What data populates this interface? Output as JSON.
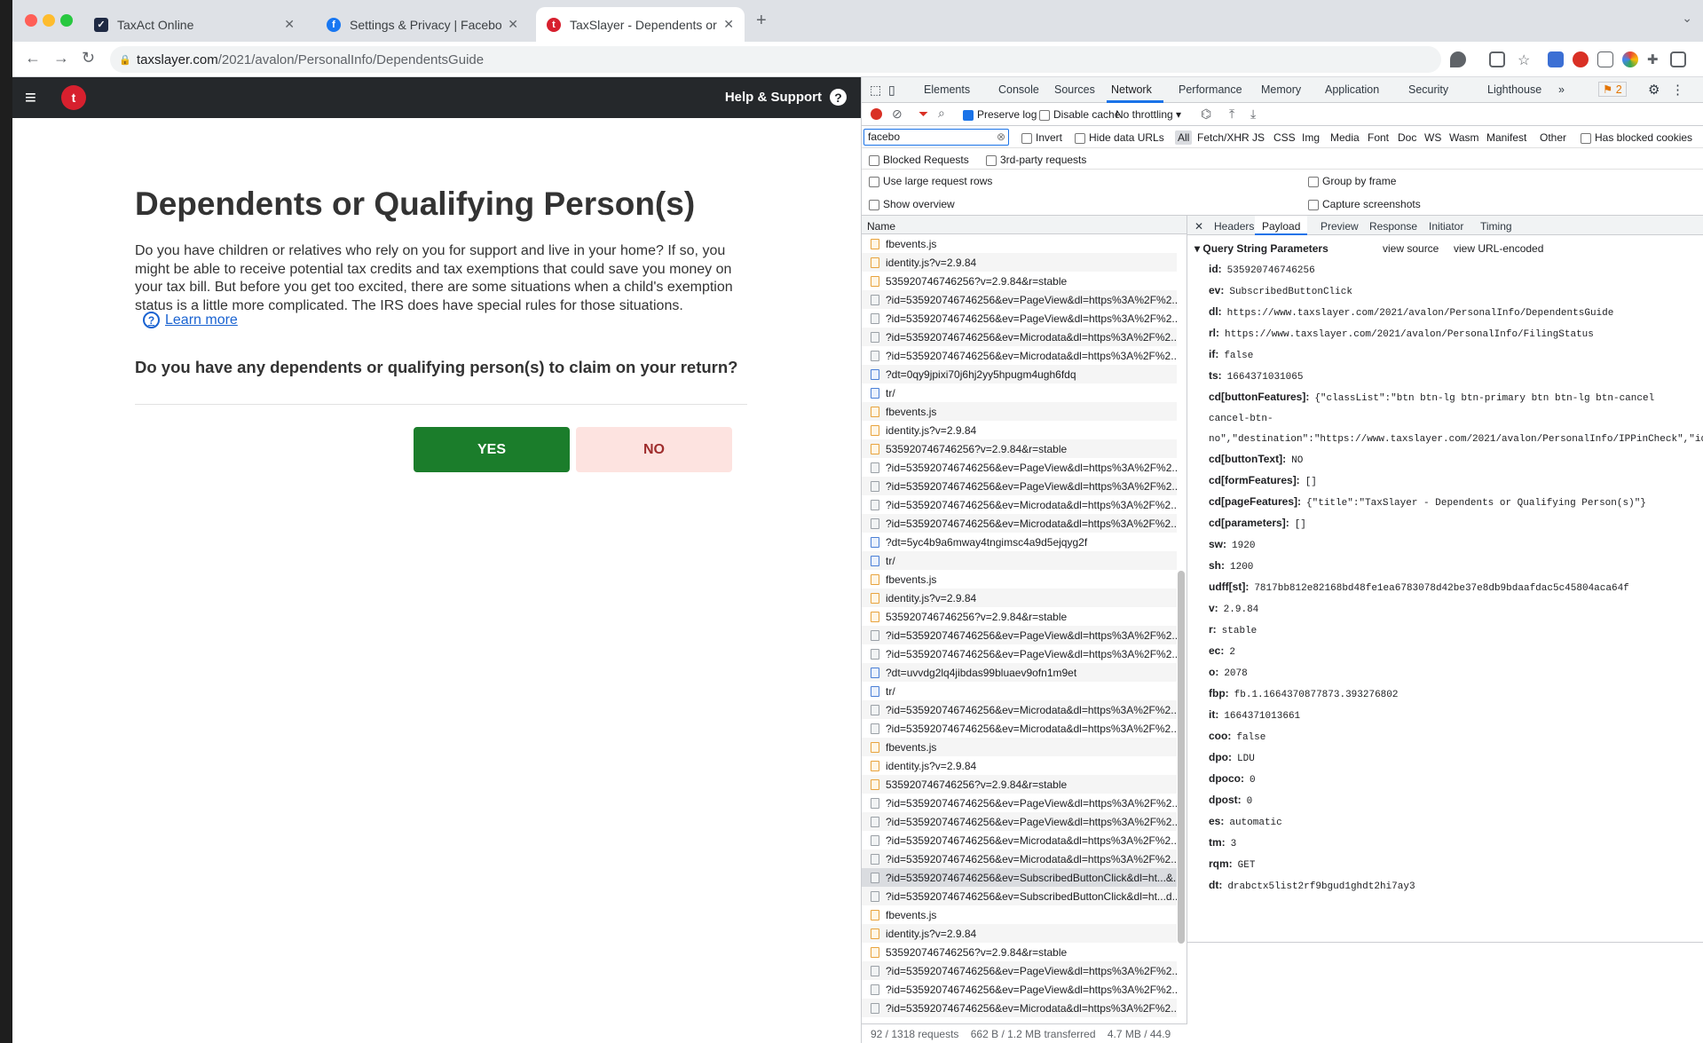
{
  "browser": {
    "tabs": [
      {
        "title": "TaxAct Online"
      },
      {
        "title": "Settings & Privacy | Facebook"
      },
      {
        "title": "TaxSlayer - Dependents or Qua"
      }
    ],
    "url_domain": "taxslayer.com",
    "url_path": "/2021/avalon/PersonalInfo/DependentsGuide"
  },
  "site": {
    "help_label": "Help & Support",
    "page_title": "Dependents or Qualifying Person(s)",
    "description": "Do you have children or relatives who rely on you for support and live in your home? If so, you might be able to receive potential tax credits and tax exemptions that could save you money on your tax bill. But before you get too excited, there are some situations when a child's exemption status is a little more complicated. The IRS does have special rules for those situations.",
    "learn_more": "Learn more",
    "question": "Do you have any dependents or qualifying person(s) to claim on your return?",
    "yes_label": "YES",
    "no_label": "NO"
  },
  "devtools": {
    "tabs": [
      "Elements",
      "Console",
      "Sources",
      "Network",
      "Performance",
      "Memory",
      "Application",
      "Security",
      "Lighthouse"
    ],
    "issues_count": "2",
    "toolbar": {
      "preserve_log": "Preserve log",
      "disable_cache": "Disable cache",
      "throttling": "No throttling"
    },
    "filter_value": "facebo",
    "filter_options": {
      "invert": "Invert",
      "hide_data_urls": "Hide data URLs",
      "has_blocked_cookies": "Has blocked cookies",
      "blocked_requests": "Blocked Requests",
      "third_party": "3rd-party requests"
    },
    "type_filters": [
      "All",
      "Fetch/XHR",
      "JS",
      "CSS",
      "Img",
      "Media",
      "Font",
      "Doc",
      "WS",
      "Wasm",
      "Manifest",
      "Other"
    ],
    "settings": {
      "large_rows": "Use large request rows",
      "show_overview": "Show overview",
      "group_by_frame": "Group by frame",
      "capture_screenshots": "Capture screenshots"
    },
    "name_header": "Name",
    "requests": [
      {
        "name": "fbevents.js",
        "type": "js"
      },
      {
        "name": "identity.js?v=2.9.84",
        "type": "js"
      },
      {
        "name": "535920746746256?v=2.9.84&r=stable",
        "type": "js"
      },
      {
        "name": "?id=535920746746256&ev=PageView&dl=https%3A%2F%2...",
        "type": "ping"
      },
      {
        "name": "?id=535920746746256&ev=PageView&dl=https%3A%2F%2...",
        "type": "ping"
      },
      {
        "name": "?id=535920746746256&ev=Microdata&dl=https%3A%2F%2...",
        "type": "ping"
      },
      {
        "name": "?id=535920746746256&ev=Microdata&dl=https%3A%2F%2...",
        "type": "ping"
      },
      {
        "name": "?dt=0qy9jpixi70j6hj2yy5hpugm4ugh6fdq",
        "type": "doc"
      },
      {
        "name": "tr/",
        "type": "doc"
      },
      {
        "name": "fbevents.js",
        "type": "js"
      },
      {
        "name": "identity.js?v=2.9.84",
        "type": "js"
      },
      {
        "name": "535920746746256?v=2.9.84&r=stable",
        "type": "js"
      },
      {
        "name": "?id=535920746746256&ev=PageView&dl=https%3A%2F%2...",
        "type": "ping"
      },
      {
        "name": "?id=535920746746256&ev=PageView&dl=https%3A%2F%2...",
        "type": "ping"
      },
      {
        "name": "?id=535920746746256&ev=Microdata&dl=https%3A%2F%2...",
        "type": "ping"
      },
      {
        "name": "?id=535920746746256&ev=Microdata&dl=https%3A%2F%2...",
        "type": "ping"
      },
      {
        "name": "?dt=5yc4b9a6mway4tngimsc4a9d5ejqyg2f",
        "type": "doc"
      },
      {
        "name": "tr/",
        "type": "doc"
      },
      {
        "name": "fbevents.js",
        "type": "js"
      },
      {
        "name": "identity.js?v=2.9.84",
        "type": "js"
      },
      {
        "name": "535920746746256?v=2.9.84&r=stable",
        "type": "js"
      },
      {
        "name": "?id=535920746746256&ev=PageView&dl=https%3A%2F%2...",
        "type": "ping"
      },
      {
        "name": "?id=535920746746256&ev=PageView&dl=https%3A%2F%2...",
        "type": "ping"
      },
      {
        "name": "?dt=uvvdg2lq4jibdas99bluaev9ofn1m9et",
        "type": "doc"
      },
      {
        "name": "tr/",
        "type": "doc"
      },
      {
        "name": "?id=535920746746256&ev=Microdata&dl=https%3A%2F%2...",
        "type": "ping"
      },
      {
        "name": "?id=535920746746256&ev=Microdata&dl=https%3A%2F%2...",
        "type": "ping"
      },
      {
        "name": "fbevents.js",
        "type": "js"
      },
      {
        "name": "identity.js?v=2.9.84",
        "type": "js"
      },
      {
        "name": "535920746746256?v=2.9.84&r=stable",
        "type": "js"
      },
      {
        "name": "?id=535920746746256&ev=PageView&dl=https%3A%2F%2...",
        "type": "ping"
      },
      {
        "name": "?id=535920746746256&ev=PageView&dl=https%3A%2F%2...",
        "type": "ping"
      },
      {
        "name": "?id=535920746746256&ev=Microdata&dl=https%3A%2F%2...",
        "type": "ping"
      },
      {
        "name": "?id=535920746746256&ev=Microdata&dl=https%3A%2F%2...",
        "type": "ping"
      },
      {
        "name": "?id=535920746746256&ev=SubscribedButtonClick&dl=ht...&...",
        "type": "ping",
        "selected": true
      },
      {
        "name": "?id=535920746746256&ev=SubscribedButtonClick&dl=ht...d...",
        "type": "ping"
      },
      {
        "name": "fbevents.js",
        "type": "js"
      },
      {
        "name": "identity.js?v=2.9.84",
        "type": "js"
      },
      {
        "name": "535920746746256?v=2.9.84&r=stable",
        "type": "js"
      },
      {
        "name": "?id=535920746746256&ev=PageView&dl=https%3A%2F%2...",
        "type": "ping"
      },
      {
        "name": "?id=535920746746256&ev=PageView&dl=https%3A%2F%2...",
        "type": "ping"
      },
      {
        "name": "?id=535920746746256&ev=Microdata&dl=https%3A%2F%2...",
        "type": "ping"
      }
    ],
    "status": {
      "requests": "92 / 1318 requests",
      "transferred": "662 B / 1.2 MB transferred",
      "resources": "4.7 MB / 44.9"
    },
    "detail_tabs": [
      "Headers",
      "Payload",
      "Preview",
      "Response",
      "Initiator",
      "Timing"
    ],
    "qsp_title": "Query String Parameters",
    "view_source": "view source",
    "view_url_encoded": "view URL-encoded",
    "params": [
      {
        "k": "id:",
        "v": "535920746746256"
      },
      {
        "k": "ev:",
        "v": "SubscribedButtonClick"
      },
      {
        "k": "dl:",
        "v": "https://www.taxslayer.com/2021/avalon/PersonalInfo/DependentsGuide"
      },
      {
        "k": "rl:",
        "v": "https://www.taxslayer.com/2021/avalon/PersonalInfo/FilingStatus"
      },
      {
        "k": "if:",
        "v": "false"
      },
      {
        "k": "ts:",
        "v": "1664371031065"
      },
      {
        "k": "cd[buttonFeatures]:",
        "v": "{\"classList\":\"btn btn-lg btn-primary btn btn-lg btn-cancel cancel-btn-no\",\"destination\":\"https://www.taxslayer.com/2021/avalon/PersonalInfo/IPPinCheck\",\"id\":\"\",\"imageUrl\":\"\",\"innerText\":\"NO\",\"numChildButtons\":0,\"tag\":\"a\",\"type\":null,\"name\":\"\"}",
        "wrap": true
      },
      {
        "k": "cd[buttonText]:",
        "v": "NO"
      },
      {
        "k": "cd[formFeatures]:",
        "v": "[]"
      },
      {
        "k": "cd[pageFeatures]:",
        "v": "{\"title\":\"TaxSlayer - Dependents or Qualifying Person(s)\"}"
      },
      {
        "k": "cd[parameters]:",
        "v": "[]"
      },
      {
        "k": "sw:",
        "v": "1920"
      },
      {
        "k": "sh:",
        "v": "1200"
      },
      {
        "k": "udff[st]:",
        "v": "7817bb812e82168bd48fe1ea6783078d42be37e8db9bdaafdac5c45804aca64f"
      },
      {
        "k": "v:",
        "v": "2.9.84"
      },
      {
        "k": "r:",
        "v": "stable"
      },
      {
        "k": "ec:",
        "v": "2"
      },
      {
        "k": "o:",
        "v": "2078"
      },
      {
        "k": "fbp:",
        "v": "fb.1.1664370877873.393276802"
      },
      {
        "k": "it:",
        "v": "1664371013661"
      },
      {
        "k": "coo:",
        "v": "false"
      },
      {
        "k": "dpo:",
        "v": "LDU"
      },
      {
        "k": "dpoco:",
        "v": "0"
      },
      {
        "k": "dpost:",
        "v": "0"
      },
      {
        "k": "es:",
        "v": "automatic"
      },
      {
        "k": "tm:",
        "v": "3"
      },
      {
        "k": "rqm:",
        "v": "GET"
      },
      {
        "k": "dt:",
        "v": "drabctx5list2rf9bgud1ghdt2hi7ay3"
      }
    ]
  }
}
